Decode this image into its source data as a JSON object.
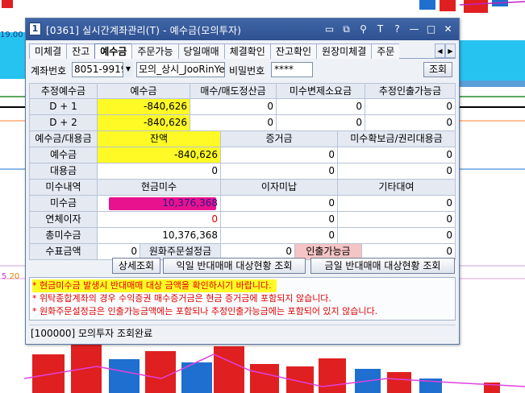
{
  "background": {
    "left_label_top": "19.00",
    "left_label_bottom": "5",
    "left_label_bottom2": "20"
  },
  "window": {
    "number": "1",
    "title": "[0361] 실시간계좌관리(T) - 예수금(모의투자)",
    "title_icons": [
      "restore-icon",
      "copy-icon",
      "pin-icon",
      "font-icon",
      "help-icon",
      "minimize-icon",
      "maximize-icon",
      "close-icon"
    ]
  },
  "tabs": [
    "미체결",
    "잔고",
    "예수금",
    "주문가능",
    "당일매매",
    "체결확인",
    "잔고확인",
    "원장미체결",
    "주문"
  ],
  "active_tab": "예수금",
  "account": {
    "label": "계좌번호",
    "number": "8051-9919",
    "name": "모의_상시_JooRinYe",
    "password_label": "비밀번호",
    "password": "****",
    "query_label": "조회"
  },
  "grid": {
    "h1": [
      "추정예수금",
      "예수금",
      "매수/매도정산금",
      "미수변제소요금",
      "추정인출가능금"
    ],
    "d1": [
      "D + 1",
      "-840,626",
      "0",
      "0",
      "0"
    ],
    "d2": [
      "D + 2",
      "-840,626",
      "0",
      "0",
      "0"
    ],
    "h2": [
      "예수금/대용금",
      "잔액",
      "증거금",
      "미수확보금/권리대용금"
    ],
    "r1": [
      "예수금",
      "-840,626",
      "0",
      "0"
    ],
    "r2": [
      "대용금",
      "0",
      "0",
      "0"
    ],
    "h3": [
      "미수내역",
      "현금미수",
      "이자미납",
      "기타대여"
    ],
    "r3": [
      "미수금",
      "10,376,368",
      "0",
      "0"
    ],
    "r4": [
      "연체이자",
      "0",
      "0",
      "0"
    ],
    "r5": [
      "총미수금",
      "10,376,368",
      "0",
      "0"
    ],
    "r6": [
      "수표금액",
      "0",
      "원화주문설정금",
      "0",
      "인출가능금",
      "0"
    ]
  },
  "buttons": {
    "detail": "상세조회",
    "next_day": "익일 반대매매 대상현황 조회",
    "today": "금일 반대매매 대상현황 조회"
  },
  "notes": [
    "* 현금미수금 발생시 반대매매 대상 금액을 확인하시기 바랍니다.",
    "* 위탁종합계좌의 경우 수익증권 매수증거금은 현금 증거금에 포함되지 않습니다.",
    "* 원화주문설정금은 인출가능금액에는 포함되나 추정인출가능금에는 포함되어 있지 않습니다."
  ],
  "status": "[100000] 모의투자 조회완료",
  "colors": {
    "titlebar": "#2f5192",
    "highlight_yellow": "#fffa26",
    "highlight_magenta": "#e8128e",
    "negative": "#e00000"
  }
}
